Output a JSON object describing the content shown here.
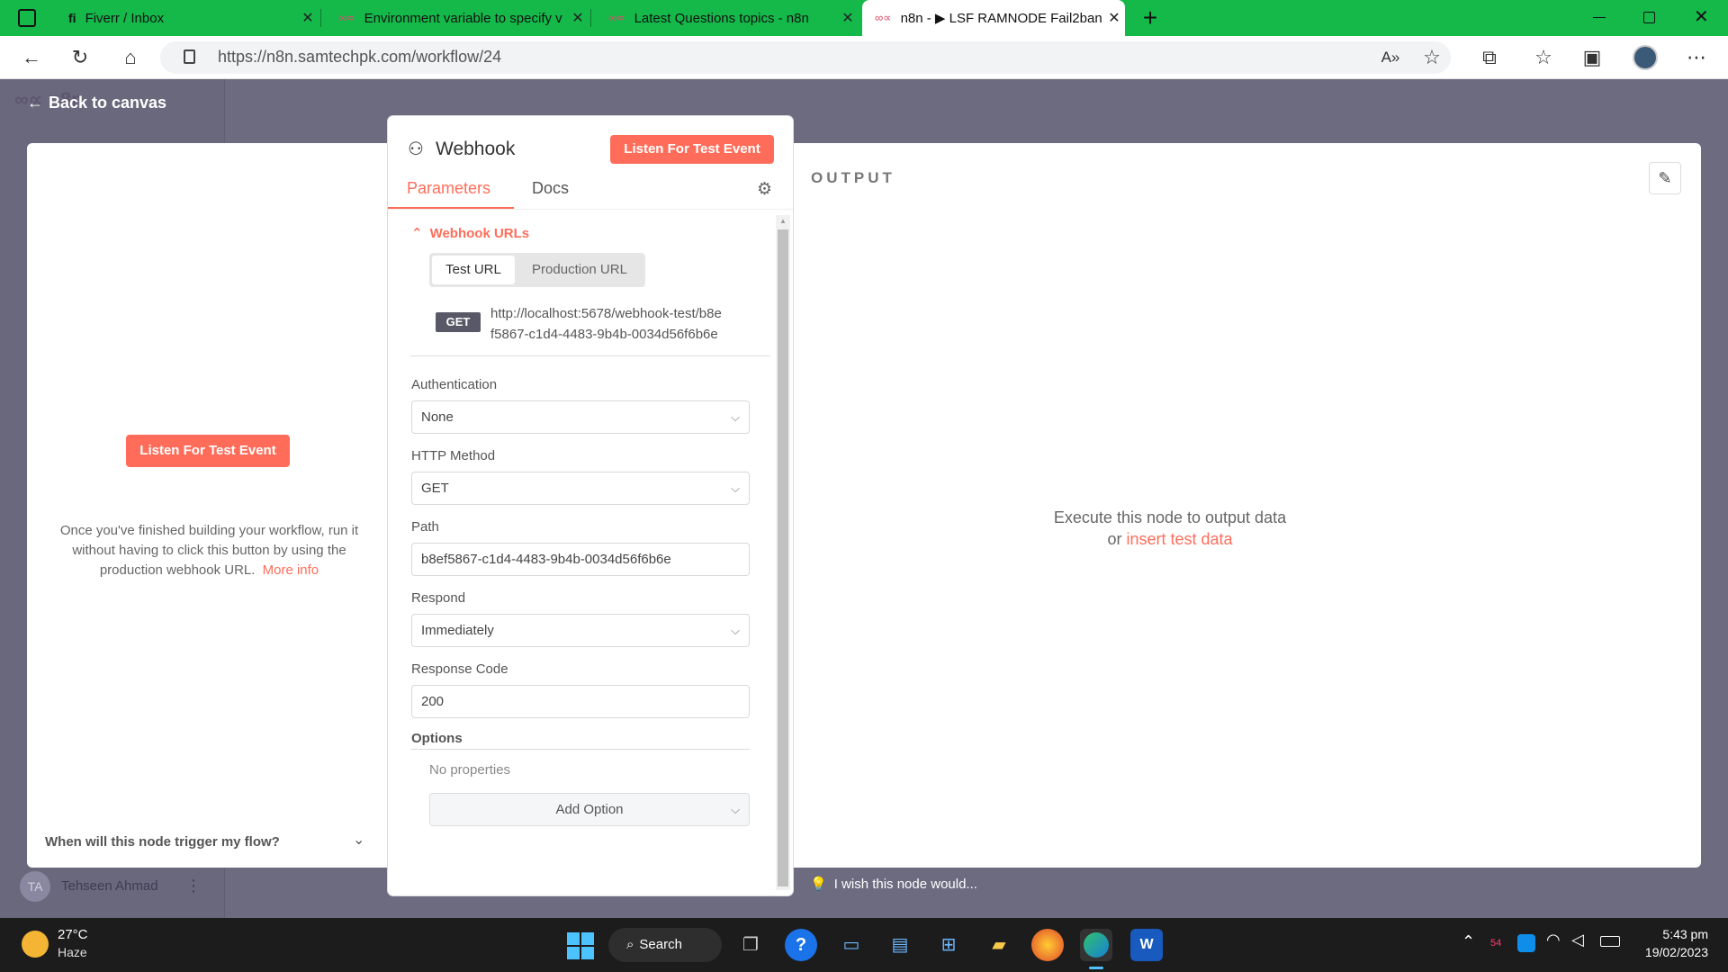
{
  "browser": {
    "tabs": [
      {
        "icon": "fiverr-icon",
        "title": "Fiverr / Inbox",
        "active": false
      },
      {
        "icon": "n8n-icon",
        "title": "Environment variable to specify v",
        "active": false
      },
      {
        "icon": "n8n-icon",
        "title": "Latest Questions topics - n8n",
        "active": false
      },
      {
        "icon": "n8n-icon",
        "title": "n8n - ▶ LSF RAMNODE Fail2ban",
        "active": true
      }
    ],
    "url": "https://n8n.samtechpk.com/workflow/24",
    "close_glyph": "✕",
    "new_tab_glyph": "+"
  },
  "app": {
    "back_label": "Back to canvas",
    "logo_text": "n8n",
    "user_initials": "TA",
    "user_name": "Tehseen Ahmad"
  },
  "left_panel": {
    "listen_button": "Listen For Test Event",
    "help_text": "Once you've finished building your workflow, run it without having to click this button by using the production webhook URL.",
    "more_info": "More info",
    "trigger_question": "When will this node trigger my flow?"
  },
  "node": {
    "title": "Webhook",
    "listen_button": "Listen For Test Event",
    "tabs": {
      "parameters": "Parameters",
      "docs": "Docs"
    },
    "webhook_urls": {
      "heading": "Webhook URLs",
      "toggle_test": "Test URL",
      "toggle_production": "Production URL",
      "method": "GET",
      "url_line1": "http://localhost:5678/webhook-test/b8e",
      "url_line2": "f5867-c1d4-4483-9b4b-0034d56f6b6e"
    },
    "fields": {
      "authentication": {
        "label": "Authentication",
        "value": "None"
      },
      "http_method": {
        "label": "HTTP Method",
        "value": "GET"
      },
      "path": {
        "label": "Path",
        "value": "b8ef5867-c1d4-4483-9b4b-0034d56f6b6e"
      },
      "respond": {
        "label": "Respond",
        "value": "Immediately"
      },
      "response_code": {
        "label": "Response Code",
        "value": "200"
      }
    },
    "options": {
      "label": "Options",
      "empty": "No properties",
      "add_button": "Add Option"
    },
    "feedback": "I wish this node would..."
  },
  "output": {
    "title": "OUTPUT",
    "empty_line1": "Execute this node to output data",
    "empty_or": "or",
    "insert_link": "insert test data"
  },
  "taskbar": {
    "weather_temp": "27°C",
    "weather_desc": "Haze",
    "search_label": "Search",
    "time": "5:43 pm",
    "date": "19/02/2023",
    "badge_count": "54"
  },
  "colors": {
    "brand": "#ff6d5a",
    "tabbar": "#14b94a",
    "canvas": "#6d6b80"
  }
}
